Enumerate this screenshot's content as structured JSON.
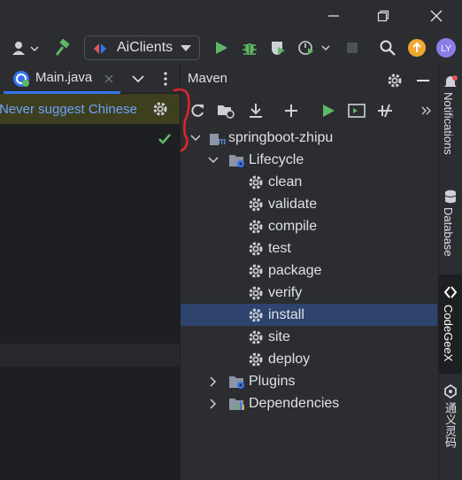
{
  "window": {
    "minimize_icon": "minimize-icon",
    "maximize_icon": "restore-icon",
    "close_icon": "close-icon"
  },
  "toolbar": {
    "run_config": "AiClients",
    "icons": [
      "user-icon",
      "hammer-icon",
      "run-icon",
      "debug-icon",
      "coverage-icon",
      "profiler-icon",
      "stop-icon",
      "search-icon",
      "update-icon",
      "avatar"
    ],
    "avatar_initials": "LY"
  },
  "editor": {
    "tab_label": "Main.java",
    "banner_text": "Never suggest Chinese"
  },
  "maven": {
    "title": "Maven",
    "toolbar_icons": [
      "reload-icon",
      "add-project-icon",
      "download-icon",
      "plus-icon",
      "run-icon",
      "terminal-icon",
      "skip-tests-icon",
      "more-icon"
    ],
    "tree": {
      "project": "springboot-zhipu",
      "lifecycle_label": "Lifecycle",
      "lifecycle": [
        "clean",
        "validate",
        "compile",
        "test",
        "package",
        "verify",
        "install",
        "site",
        "deploy"
      ],
      "selected": "install",
      "plugins_label": "Plugins",
      "dependencies_label": "Dependencies"
    }
  },
  "sidebar": {
    "notifications": "Notifications",
    "database": "Database",
    "codegeex": "CodeGeeX",
    "tongyi": "通义灵码"
  },
  "colors": {
    "accent": "#3574f0",
    "run_green": "#5fb865",
    "selected_row": "#2e436e",
    "banner_bg": "#3d3f1f",
    "annotation_red": "#d9262c"
  }
}
